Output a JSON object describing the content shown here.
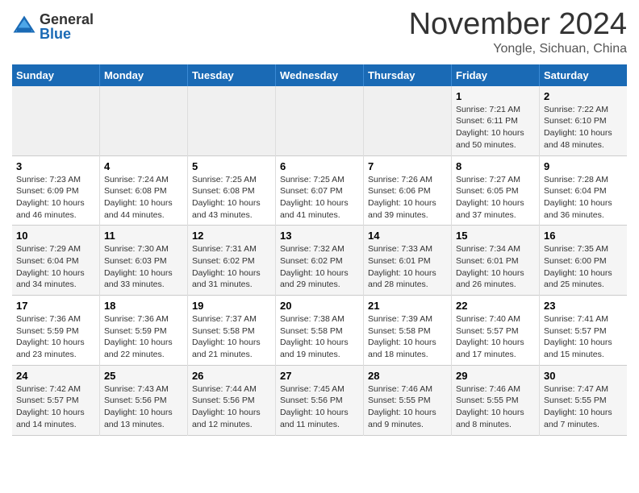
{
  "header": {
    "logo_general": "General",
    "logo_blue": "Blue",
    "month": "November 2024",
    "location": "Yongle, Sichuan, China"
  },
  "weekdays": [
    "Sunday",
    "Monday",
    "Tuesday",
    "Wednesday",
    "Thursday",
    "Friday",
    "Saturday"
  ],
  "weeks": [
    [
      {
        "day": "",
        "info": "",
        "empty": true
      },
      {
        "day": "",
        "info": "",
        "empty": true
      },
      {
        "day": "",
        "info": "",
        "empty": true
      },
      {
        "day": "",
        "info": "",
        "empty": true
      },
      {
        "day": "",
        "info": "",
        "empty": true
      },
      {
        "day": "1",
        "info": "Sunrise: 7:21 AM\nSunset: 6:11 PM\nDaylight: 10 hours\nand 50 minutes."
      },
      {
        "day": "2",
        "info": "Sunrise: 7:22 AM\nSunset: 6:10 PM\nDaylight: 10 hours\nand 48 minutes."
      }
    ],
    [
      {
        "day": "3",
        "info": "Sunrise: 7:23 AM\nSunset: 6:09 PM\nDaylight: 10 hours\nand 46 minutes."
      },
      {
        "day": "4",
        "info": "Sunrise: 7:24 AM\nSunset: 6:08 PM\nDaylight: 10 hours\nand 44 minutes."
      },
      {
        "day": "5",
        "info": "Sunrise: 7:25 AM\nSunset: 6:08 PM\nDaylight: 10 hours\nand 43 minutes."
      },
      {
        "day": "6",
        "info": "Sunrise: 7:25 AM\nSunset: 6:07 PM\nDaylight: 10 hours\nand 41 minutes."
      },
      {
        "day": "7",
        "info": "Sunrise: 7:26 AM\nSunset: 6:06 PM\nDaylight: 10 hours\nand 39 minutes."
      },
      {
        "day": "8",
        "info": "Sunrise: 7:27 AM\nSunset: 6:05 PM\nDaylight: 10 hours\nand 37 minutes."
      },
      {
        "day": "9",
        "info": "Sunrise: 7:28 AM\nSunset: 6:04 PM\nDaylight: 10 hours\nand 36 minutes."
      }
    ],
    [
      {
        "day": "10",
        "info": "Sunrise: 7:29 AM\nSunset: 6:04 PM\nDaylight: 10 hours\nand 34 minutes."
      },
      {
        "day": "11",
        "info": "Sunrise: 7:30 AM\nSunset: 6:03 PM\nDaylight: 10 hours\nand 33 minutes."
      },
      {
        "day": "12",
        "info": "Sunrise: 7:31 AM\nSunset: 6:02 PM\nDaylight: 10 hours\nand 31 minutes."
      },
      {
        "day": "13",
        "info": "Sunrise: 7:32 AM\nSunset: 6:02 PM\nDaylight: 10 hours\nand 29 minutes."
      },
      {
        "day": "14",
        "info": "Sunrise: 7:33 AM\nSunset: 6:01 PM\nDaylight: 10 hours\nand 28 minutes."
      },
      {
        "day": "15",
        "info": "Sunrise: 7:34 AM\nSunset: 6:01 PM\nDaylight: 10 hours\nand 26 minutes."
      },
      {
        "day": "16",
        "info": "Sunrise: 7:35 AM\nSunset: 6:00 PM\nDaylight: 10 hours\nand 25 minutes."
      }
    ],
    [
      {
        "day": "17",
        "info": "Sunrise: 7:36 AM\nSunset: 5:59 PM\nDaylight: 10 hours\nand 23 minutes."
      },
      {
        "day": "18",
        "info": "Sunrise: 7:36 AM\nSunset: 5:59 PM\nDaylight: 10 hours\nand 22 minutes."
      },
      {
        "day": "19",
        "info": "Sunrise: 7:37 AM\nSunset: 5:58 PM\nDaylight: 10 hours\nand 21 minutes."
      },
      {
        "day": "20",
        "info": "Sunrise: 7:38 AM\nSunset: 5:58 PM\nDaylight: 10 hours\nand 19 minutes."
      },
      {
        "day": "21",
        "info": "Sunrise: 7:39 AM\nSunset: 5:58 PM\nDaylight: 10 hours\nand 18 minutes."
      },
      {
        "day": "22",
        "info": "Sunrise: 7:40 AM\nSunset: 5:57 PM\nDaylight: 10 hours\nand 17 minutes."
      },
      {
        "day": "23",
        "info": "Sunrise: 7:41 AM\nSunset: 5:57 PM\nDaylight: 10 hours\nand 15 minutes."
      }
    ],
    [
      {
        "day": "24",
        "info": "Sunrise: 7:42 AM\nSunset: 5:57 PM\nDaylight: 10 hours\nand 14 minutes."
      },
      {
        "day": "25",
        "info": "Sunrise: 7:43 AM\nSunset: 5:56 PM\nDaylight: 10 hours\nand 13 minutes."
      },
      {
        "day": "26",
        "info": "Sunrise: 7:44 AM\nSunset: 5:56 PM\nDaylight: 10 hours\nand 12 minutes."
      },
      {
        "day": "27",
        "info": "Sunrise: 7:45 AM\nSunset: 5:56 PM\nDaylight: 10 hours\nand 11 minutes."
      },
      {
        "day": "28",
        "info": "Sunrise: 7:46 AM\nSunset: 5:55 PM\nDaylight: 10 hours\nand 9 minutes."
      },
      {
        "day": "29",
        "info": "Sunrise: 7:46 AM\nSunset: 5:55 PM\nDaylight: 10 hours\nand 8 minutes."
      },
      {
        "day": "30",
        "info": "Sunrise: 7:47 AM\nSunset: 5:55 PM\nDaylight: 10 hours\nand 7 minutes."
      }
    ]
  ]
}
